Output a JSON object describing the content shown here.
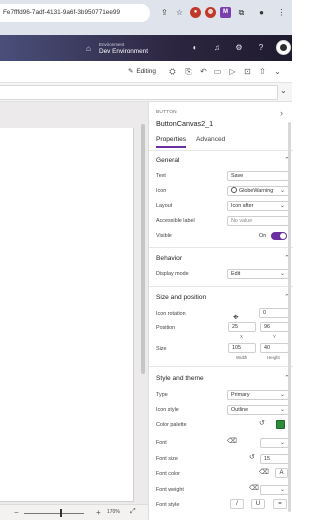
{
  "browser": {
    "url": "Fe7fffd96-7adf-4131-9a6f-3b950771ee99",
    "accent_extension": "#7b3fb0"
  },
  "header": {
    "env_label": "Environment",
    "env_name": "Dev Environment"
  },
  "command_bar": {
    "editing_label": "Editing"
  },
  "canvas": {
    "zoom": "170%"
  },
  "pane": {
    "control_type": "BUTTON",
    "control_name": "ButtonCanvas2_1",
    "tabs": [
      "Properties",
      "Advanced"
    ],
    "general": {
      "title": "General",
      "text_label": "Text",
      "text_value": "Save",
      "icon_label": "Icon",
      "icon_value": "GlobeWarning",
      "layout_label": "Layout",
      "layout_value": "Icon after",
      "accessible_label": "Accessible label",
      "accessible_placeholder": "No value",
      "visible_label": "Visible",
      "visible_value": "On"
    },
    "behavior": {
      "title": "Behavior",
      "display_mode_label": "Display mode",
      "display_mode_value": "Edit"
    },
    "size_position": {
      "title": "Size and position",
      "icon_rotation_label": "Icon rotation",
      "icon_rotation_value": "0",
      "position_label": "Position",
      "x_value": "25",
      "y_value": "96",
      "x_caption": "X",
      "y_caption": "Y",
      "size_label": "Size",
      "width_value": "105",
      "height_value": "40",
      "width_caption": "Width",
      "height_caption": "Height"
    },
    "style_theme": {
      "title": "Style and theme",
      "type_label": "Type",
      "type_value": "Primary",
      "icon_style_label": "Icon style",
      "icon_style_value": "Outline",
      "color_palette_label": "Color palette",
      "font_label": "Font",
      "font_size_label": "Font size",
      "font_size_value": "15",
      "font_color_label": "Font color",
      "font_weight_label": "Font weight",
      "font_style_label": "Font style",
      "italic_glyph": "/",
      "underline_glyph": "U",
      "strike_glyph": "="
    }
  }
}
